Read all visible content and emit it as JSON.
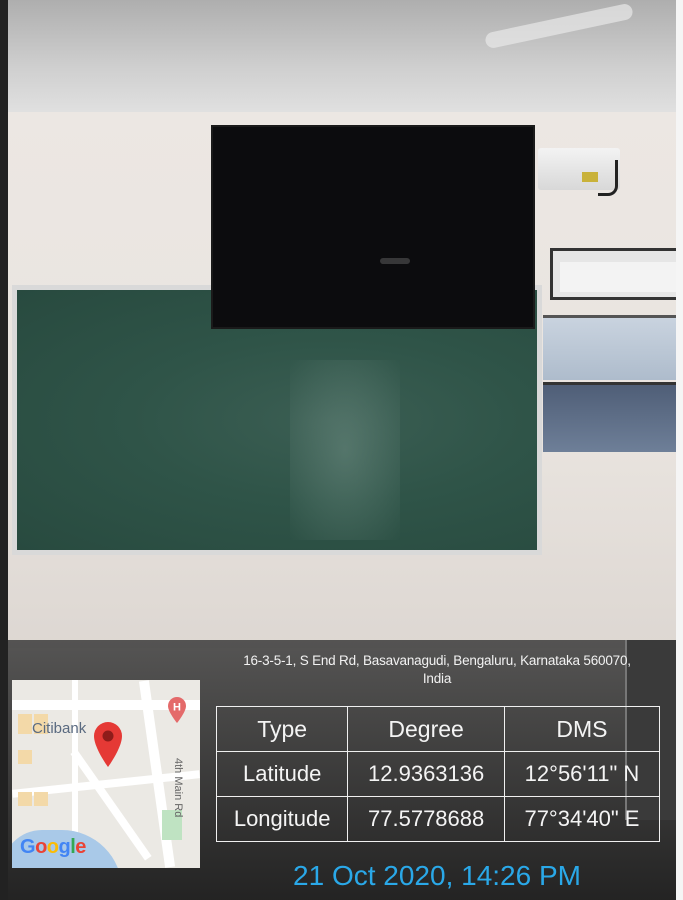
{
  "address": {
    "line1": "16-3-5-1, S End Rd, Basavanagudi, Bengaluru, Karnataka 560070,",
    "line2": "India"
  },
  "map": {
    "place_label": "Citibank",
    "road_label": "4th Main Rd",
    "logo_text": "Google",
    "pin_icon": "location-pin-icon",
    "marker_icon": "hospital-marker-icon",
    "pin_color": "#e53935",
    "water_color": "#a9c9e8"
  },
  "coordinates": {
    "headers": [
      "Type",
      "Degree",
      "DMS"
    ],
    "rows": [
      {
        "type": "Latitude",
        "degree": "12.9363136",
        "dms": "12°56'11\" N"
      },
      {
        "type": "Longitude",
        "degree": "77.5778688",
        "dms": "77°34'40\" E"
      }
    ]
  },
  "timestamp": "21 Oct 2020, 14:26 PM",
  "colors": {
    "timestamp": "#2aa8e8",
    "chalkboard": "#2f5448",
    "text_overlay": "#f4f4f4"
  }
}
